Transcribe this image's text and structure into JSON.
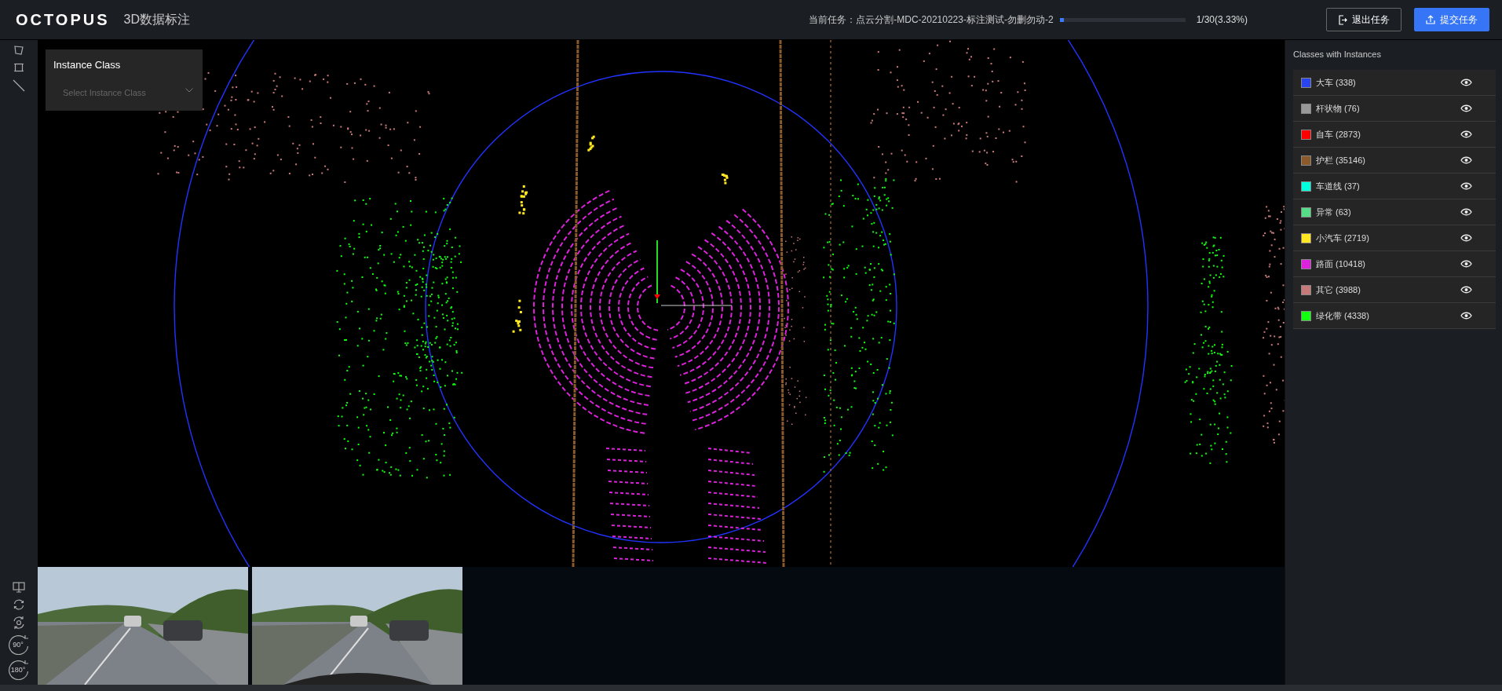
{
  "header": {
    "logo": "OCTOPUS",
    "app_title": "3D数据标注",
    "task": "当前任务：点云分割-MDC-20210223-标注测试-勿删勿动-2",
    "progress": {
      "level": 0.0333,
      "reading": "1/30(3.33%)"
    },
    "buttons": [
      {
        "kind": "exit",
        "label": "退出任务"
      },
      {
        "kind": "submit",
        "label": "提交任务"
      }
    ]
  },
  "tools": [
    {
      "kind": "polygon"
    },
    {
      "kind": "box"
    },
    {
      "kind": "line"
    }
  ],
  "view_tools": [
    {
      "kind": "monitor"
    },
    {
      "kind": "refresh"
    },
    {
      "kind": "reset"
    },
    {
      "kind": "rotate",
      "label": "90°"
    },
    {
      "kind": "rotate",
      "label": "180°"
    }
  ],
  "instance_panel": {
    "title": "Instance Class",
    "select": {
      "placeholder": "Select Instance Class"
    }
  },
  "classes": {
    "title": "Classes with Instances",
    "items": [
      {
        "label": "大车 (338)",
        "color": "#2a44f0"
      },
      {
        "label": "杆状物 (76)",
        "color": "#999999"
      },
      {
        "label": "自车 (2873)",
        "color": "#ff0000"
      },
      {
        "label": "护栏 (35146)",
        "color": "#8b5a2b"
      },
      {
        "label": "车道线 (37)",
        "color": "#00ffdd"
      },
      {
        "label": "异常 (63)",
        "color": "#55dd88"
      },
      {
        "label": "小汽车 (2719)",
        "color": "#ffe822"
      },
      {
        "label": "路面 (10418)",
        "color": "#dd22dd"
      },
      {
        "label": "其它 (3988)",
        "color": "#c87a7a"
      },
      {
        "label": "绿化带 (4338)",
        "color": "#11ff11"
      }
    ]
  }
}
